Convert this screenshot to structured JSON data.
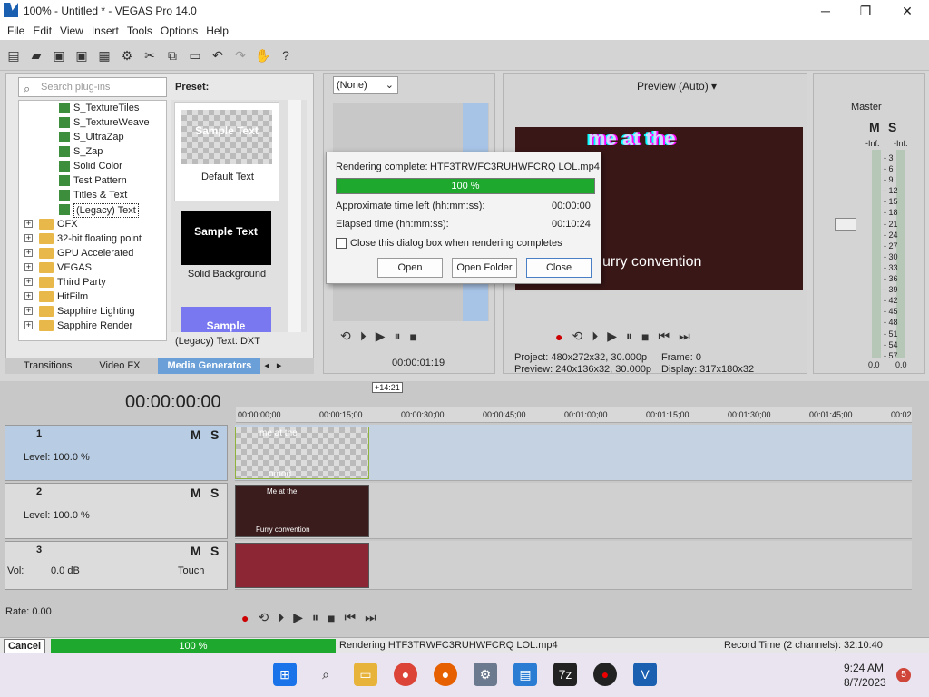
{
  "window": {
    "title": "100% - Untitled * - VEGAS Pro 14.0"
  },
  "menu": [
    "File",
    "Edit",
    "View",
    "Insert",
    "Tools",
    "Options",
    "Help"
  ],
  "plugins": {
    "search_placeholder": "Search plug-ins",
    "items": [
      {
        "label": "S_TextureTiles",
        "kind": "plugin"
      },
      {
        "label": "S_TextureWeave",
        "kind": "plugin"
      },
      {
        "label": "S_UltraZap",
        "kind": "plugin"
      },
      {
        "label": "S_Zap",
        "kind": "plugin"
      },
      {
        "label": "Solid Color",
        "kind": "plugin"
      },
      {
        "label": "Test Pattern",
        "kind": "plugin"
      },
      {
        "label": "Titles & Text",
        "kind": "plugin"
      },
      {
        "label": "(Legacy) Text",
        "kind": "plugin"
      },
      {
        "label": "OFX",
        "kind": "folder"
      },
      {
        "label": "32-bit floating point",
        "kind": "folder"
      },
      {
        "label": "GPU Accelerated",
        "kind": "folder"
      },
      {
        "label": "VEGAS",
        "kind": "folder"
      },
      {
        "label": "Third Party",
        "kind": "folder"
      },
      {
        "label": "HitFilm",
        "kind": "folder"
      },
      {
        "label": "Sapphire Lighting",
        "kind": "folder"
      },
      {
        "label": "Sapphire Render",
        "kind": "folder"
      }
    ]
  },
  "presets": {
    "heading": "Preset:",
    "items": [
      {
        "sample": "Sample Text",
        "label": "Default Text",
        "style": "checker"
      },
      {
        "sample": "Sample Text",
        "label": "Solid Background",
        "style": "black"
      },
      {
        "sample": "Sample",
        "label": "",
        "style": "blue"
      }
    ],
    "footer": "(Legacy) Text: DXT"
  },
  "tabs": [
    "Transitions",
    "Video FX",
    "Media Generators"
  ],
  "trimmer": {
    "dropdown": "(None)",
    "time": "00:00:01:19"
  },
  "preview": {
    "mode": "Preview (Auto)",
    "project": "Project:  480x272x32, 30.000p",
    "frame": "Frame:     0",
    "previewinfo": "Preview:  240x136x32, 30.000p",
    "display": "Display:    317x180x32",
    "overlay_top": "me at the",
    "overlay_bottom": "urry convention"
  },
  "master": {
    "title": "Master",
    "m": "M",
    "s": "S",
    "scale": [
      "3",
      "6",
      "9",
      "12",
      "15",
      "18",
      "21",
      "24",
      "27",
      "30",
      "33",
      "36",
      "39",
      "42",
      "45",
      "48",
      "51",
      "54",
      "57"
    ],
    "inf_left": "-Inf.",
    "inf_right": "-Inf.",
    "val_left": "0.0",
    "val_right": "0.0"
  },
  "dialog": {
    "label": "Rendering complete:",
    "filename": "HTF3TRWFC3RUHWFCRQ LOL.mp4",
    "progress": "100 %",
    "time_left_label": "Approximate time left (hh:mm:ss):",
    "time_left": "00:00:00",
    "elapsed_label": "Elapsed time (hh:mm:ss):",
    "elapsed": "00:10:24",
    "checkbox": "Close this dialog box when rendering completes",
    "open": "Open",
    "open_folder": "Open Folder",
    "close": "Close"
  },
  "timeline": {
    "time": "00:00:00:00",
    "marker": "+14:21",
    "ticks": [
      "00:00:00;00",
      "00:00:15;00",
      "00:00:30;00",
      "00:00:45;00",
      "00:01:00;00",
      "00:01:15;00",
      "00:01:30;00",
      "00:01:45;00",
      "00:02"
    ],
    "tracks": [
      {
        "num": "1",
        "level": "Level: 100.0 %",
        "m": "M",
        "s": "S"
      },
      {
        "num": "2",
        "level": "Level: 100.0 %",
        "m": "M",
        "s": "S"
      },
      {
        "num": "3",
        "vol": "Vol:",
        "vol_val": "0.0 dB",
        "touch": "Touch",
        "m": "M",
        "s": "S"
      }
    ],
    "clip1_top": "me at the",
    "clip1_bot": "omod",
    "clip2_top": "Me at the",
    "clip2_bot": "Furry convention",
    "rate": "Rate: 0.00"
  },
  "status": {
    "cancel": "Cancel",
    "progress": "100 %",
    "rendering": "Rendering  HTF3TRWFC3RUHWFCRQ LOL.mp4",
    "record": "Record Time (2 channels): 32:10:40"
  },
  "taskbar": {
    "time": "9:24 AM",
    "date": "8/7/2023",
    "badge": "5"
  },
  "colors": {
    "accent": "#6a9fd8",
    "progress": "#1ea92e",
    "track_selected": "#b8cde4",
    "audio_clip": "#8c2635"
  }
}
